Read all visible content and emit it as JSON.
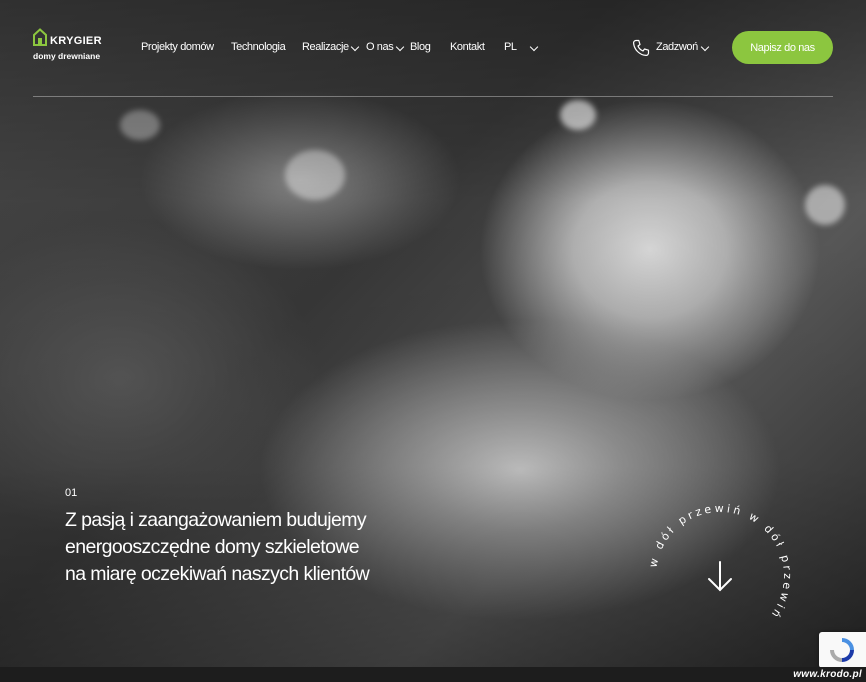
{
  "brand": {
    "name": "KRYGIER",
    "tagline": "domy drewniane",
    "accent_color": "#8cc63f"
  },
  "nav": {
    "items": [
      {
        "label": "Projekty domów",
        "has_dropdown": false
      },
      {
        "label": "Technologia",
        "has_dropdown": false
      },
      {
        "label": "Realizacje",
        "has_dropdown": true
      },
      {
        "label": "O nas",
        "has_dropdown": true
      },
      {
        "label": "Blog",
        "has_dropdown": false
      },
      {
        "label": "Kontakt",
        "has_dropdown": false
      },
      {
        "label": "PL",
        "has_dropdown": true
      }
    ],
    "phone_icon": "phone-icon",
    "phone_label": "Zadzwoń",
    "cta_label": "Napisz do nas"
  },
  "hero": {
    "slide_number": "01",
    "headline_lines": [
      "Z pasją i zaangażowaniem budujemy",
      "energooszczędne domy szkieletowe",
      "na miarę oczekiwań naszych klientów"
    ],
    "scroll_text": "w dół przewiń w dół przewiń",
    "scroll_icon": "arrow-down-icon"
  },
  "recaptcha_icon": "recaptcha-icon",
  "watermark": "www.krodo.pl"
}
